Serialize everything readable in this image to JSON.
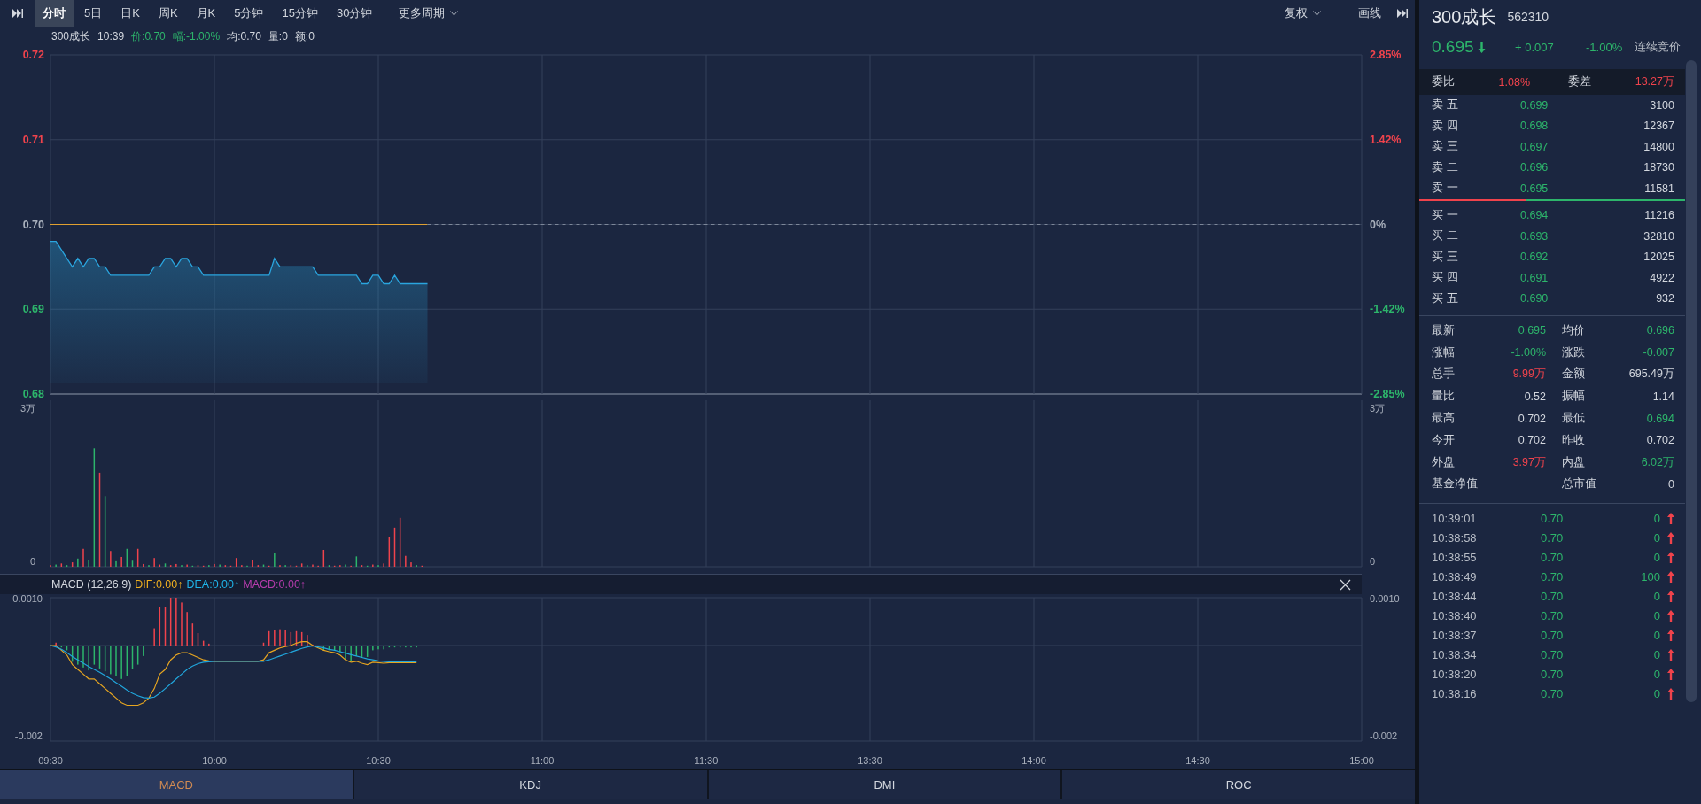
{
  "toolbar": {
    "periods": [
      {
        "label": "分时",
        "selected": true
      },
      {
        "label": "5日",
        "selected": false
      },
      {
        "label": "日K",
        "selected": false
      },
      {
        "label": "周K",
        "selected": false
      },
      {
        "label": "月K",
        "selected": false
      },
      {
        "label": "5分钟",
        "selected": false
      },
      {
        "label": "15分钟",
        "selected": false
      },
      {
        "label": "30分钟",
        "selected": false
      }
    ],
    "more": "更多周期",
    "adjust": "复权",
    "draw": "画线"
  },
  "info_line": [
    {
      "text": "300成长",
      "color": "#d3d7de"
    },
    {
      "text": "10:39",
      "color": "#d3d7de"
    },
    {
      "text": "价:0.70",
      "color": "#2db56b"
    },
    {
      "text": "幅:-1.00%",
      "color": "#2db56b"
    },
    {
      "text": "均:0.70",
      "color": "#d3d7de"
    },
    {
      "text": "量:0",
      "color": "#d3d7de"
    },
    {
      "text": "额:0",
      "color": "#d3d7de"
    }
  ],
  "price_chart": {
    "left_labels": [
      {
        "text": "0.72",
        "color": "#f0434c"
      },
      {
        "text": "0.71",
        "color": "#f0434c"
      },
      {
        "text": "0.70",
        "color": "#aab1bd"
      },
      {
        "text": "0.69",
        "color": "#2db56b"
      },
      {
        "text": "0.68",
        "color": "#2db56b"
      }
    ],
    "right_labels": [
      {
        "text": "2.85%",
        "color": "#f0434c"
      },
      {
        "text": "1.42%",
        "color": "#f0434c"
      },
      {
        "text": "0%",
        "color": "#aab1bd"
      },
      {
        "text": "-1.42%",
        "color": "#2db56b"
      },
      {
        "text": "-2.85%",
        "color": "#2db56b"
      }
    ]
  },
  "volume_chart": {
    "left_labels": [
      "3万",
      "0"
    ],
    "right_labels": [
      "3万",
      "0"
    ]
  },
  "macd_header": {
    "title": "MACD (12,26,9)",
    "values": [
      {
        "text": "DIF:0.00↑",
        "color": "#f0b020"
      },
      {
        "text": "DEA:0.00↑",
        "color": "#1fb3e8"
      },
      {
        "text": "MACD:0.00↑",
        "color": "#b43cab"
      }
    ]
  },
  "macd_chart": {
    "left_labels": [
      "0.0010",
      "-0.002"
    ],
    "right_labels": [
      "0.0010",
      "-0.002"
    ]
  },
  "time_axis": [
    "09:30",
    "10:00",
    "10:30",
    "11:00",
    "11:30",
    "13:30",
    "14:00",
    "14:30",
    "15:00"
  ],
  "indicator_tabs": [
    {
      "label": "MACD",
      "selected": true
    },
    {
      "label": "KDJ",
      "selected": false
    },
    {
      "label": "DMI",
      "selected": false
    },
    {
      "label": "ROC",
      "selected": false
    }
  ],
  "quote": {
    "name": "300成长",
    "code": "562310",
    "price": "0.695",
    "color": "#2db56b",
    "falling": true,
    "change": "+ 0.007",
    "change_pct": "-1.00%",
    "status": "连续竞价"
  },
  "order_ratio": [
    {
      "label": "委比",
      "value": "1.08%",
      "color": "#f0434c"
    },
    {
      "label": "委差",
      "value": "13.27万",
      "color": "#f0434c"
    }
  ],
  "asks": [
    {
      "label": "卖五",
      "price": "0.699",
      "volume": "3100",
      "color": "#2db56b"
    },
    {
      "label": "卖四",
      "price": "0.698",
      "volume": "12367",
      "color": "#2db56b"
    },
    {
      "label": "卖三",
      "price": "0.697",
      "volume": "14800",
      "color": "#2db56b"
    },
    {
      "label": "卖二",
      "price": "0.696",
      "volume": "18730",
      "color": "#2db56b"
    },
    {
      "label": "卖一",
      "price": "0.695",
      "volume": "11581",
      "color": "#2db56b"
    }
  ],
  "book_split": {
    "level": 0.4
  },
  "bids": [
    {
      "label": "买一",
      "price": "0.694",
      "volume": "11216",
      "color": "#2db56b"
    },
    {
      "label": "买二",
      "price": "0.693",
      "volume": "32810",
      "color": "#2db56b"
    },
    {
      "label": "买三",
      "price": "0.692",
      "volume": "12025",
      "color": "#2db56b"
    },
    {
      "label": "买四",
      "price": "0.691",
      "volume": "4922",
      "color": "#2db56b"
    },
    {
      "label": "买五",
      "price": "0.690",
      "volume": "932",
      "color": "#2db56b"
    }
  ],
  "stats": [
    {
      "label": "最新",
      "value": "0.695",
      "color": "#2db56b"
    },
    {
      "label": "均价",
      "value": "0.696",
      "color": "#2db56b"
    },
    {
      "label": "涨幅",
      "value": "-1.00%",
      "color": "#2db56b"
    },
    {
      "label": "涨跌",
      "value": "-0.007",
      "color": "#2db56b"
    },
    {
      "label": "总手",
      "value": "9.99万",
      "color": "#f0434c"
    },
    {
      "label": "金额",
      "value": "695.49万",
      "color": "#d3d7de"
    },
    {
      "label": "量比",
      "value": "0.52",
      "color": "#d3d7de"
    },
    {
      "label": "振幅",
      "value": "1.14",
      "color": "#d3d7de"
    },
    {
      "label": "最高",
      "value": "0.702",
      "color": "#d3d7de"
    },
    {
      "label": "最低",
      "value": "0.694",
      "color": "#2db56b"
    },
    {
      "label": "今开",
      "value": "0.702",
      "color": "#d3d7de"
    },
    {
      "label": "昨收",
      "value": "0.702",
      "color": "#d3d7de"
    },
    {
      "label": "外盘",
      "value": "3.97万",
      "color": "#f0434c"
    },
    {
      "label": "内盘",
      "value": "6.02万",
      "color": "#2db56b"
    },
    {
      "label": "基金净值"
    },
    {
      "label": "总市值",
      "value": "0",
      "color": "#d3d7de"
    }
  ],
  "trades": [
    {
      "time": "10:39:01",
      "price": "0.70",
      "volume": "0",
      "rising": true
    },
    {
      "time": "10:38:58",
      "price": "0.70",
      "volume": "0",
      "rising": true
    },
    {
      "time": "10:38:55",
      "price": "0.70",
      "volume": "0",
      "rising": true
    },
    {
      "time": "10:38:49",
      "price": "0.70",
      "volume": "100",
      "rising": true
    },
    {
      "time": "10:38:44",
      "price": "0.70",
      "volume": "0",
      "rising": true
    },
    {
      "time": "10:38:40",
      "price": "0.70",
      "volume": "0",
      "rising": true
    },
    {
      "time": "10:38:37",
      "price": "0.70",
      "volume": "0",
      "rising": true
    },
    {
      "time": "10:38:34",
      "price": "0.70",
      "volume": "0",
      "rising": true
    },
    {
      "time": "10:38:20",
      "price": "0.70",
      "volume": "0",
      "rising": true
    },
    {
      "time": "10:38:16",
      "price": "0.70",
      "volume": "0",
      "rising": true
    }
  ]
}
